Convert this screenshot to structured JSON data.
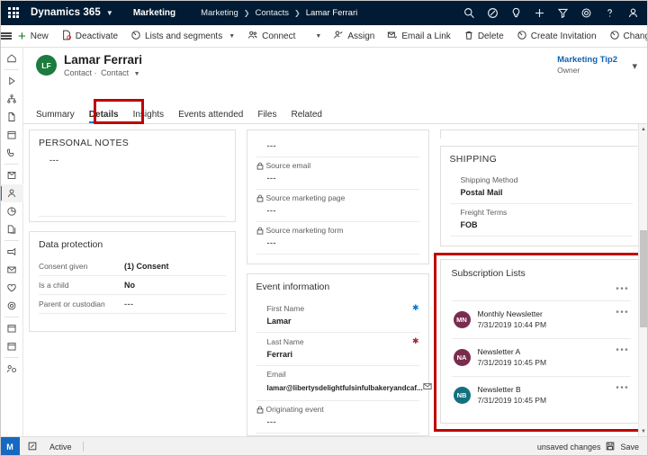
{
  "topnav": {
    "waffle_icon": "waffle-grid-icon",
    "brand": "Dynamics 365",
    "brand_chevron": "chevron-down-icon",
    "app_name": "Marketing",
    "breadcrumb": [
      "Marketing",
      "Contacts",
      "Lamar Ferrari"
    ],
    "icons": [
      "search-icon",
      "assistant-icon",
      "lightbulb-icon",
      "plus-icon",
      "filter-icon",
      "gear-icon",
      "help-icon",
      "person-icon"
    ]
  },
  "commandbar": {
    "menu_icon": "hamburger-icon",
    "items": [
      {
        "label": "New",
        "icon": "plus-icon",
        "chevron": false
      },
      {
        "label": "Deactivate",
        "icon": "deactivate-icon",
        "chevron": false
      },
      {
        "label": "Lists and segments",
        "icon": "circle-slash-icon",
        "chevron": true
      },
      {
        "label": "Connect",
        "icon": "connect-people-icon",
        "chevron": true
      },
      {
        "label": "Assign",
        "icon": "assign-person-icon",
        "chevron": false
      },
      {
        "label": "Email a Link",
        "icon": "email-link-icon",
        "chevron": false
      },
      {
        "label": "Delete",
        "icon": "trash-icon",
        "chevron": false
      },
      {
        "label": "Create Invitation",
        "icon": "circle-slash-icon",
        "chevron": false
      },
      {
        "label": "Change Password",
        "icon": "circle-slash-icon",
        "chevron": false
      }
    ],
    "overflow": "•••"
  },
  "rail": {
    "items": [
      {
        "name": "home-icon",
        "selected": false
      },
      {
        "name": "play-icon",
        "selected": false
      },
      {
        "name": "sitemap-icon",
        "selected": false
      },
      {
        "name": "file-icon",
        "selected": false
      },
      {
        "name": "calendar-icon",
        "selected": false
      },
      {
        "name": "phone-icon",
        "selected": false
      },
      {
        "name": "email-template-icon",
        "selected": false
      },
      {
        "name": "contact-person-icon",
        "selected": true
      },
      {
        "name": "pie-chart-icon",
        "selected": false
      },
      {
        "name": "segments-icon",
        "selected": false
      },
      {
        "name": "campaign-icon",
        "selected": false
      },
      {
        "name": "mail-icon",
        "selected": false
      },
      {
        "name": "heart-icon",
        "selected": false
      },
      {
        "name": "settings-gear-icon",
        "selected": false
      },
      {
        "name": "calendar-event-icon",
        "selected": false
      },
      {
        "name": "calendar-event2-icon",
        "selected": false
      },
      {
        "name": "social-icon",
        "selected": false
      }
    ]
  },
  "record": {
    "initials": "LF",
    "title": "Lamar Ferrari",
    "subtitle_entity": "Contact",
    "subtitle_sep": "·",
    "subtitle_form": "Contact",
    "subtitle_chevron": "chevron-down-icon",
    "owner_name": "Marketing Tip2",
    "owner_label": "Owner",
    "owner_chevron": "chevron-down-icon"
  },
  "tabs": [
    {
      "label": "Summary",
      "active": false
    },
    {
      "label": "Details",
      "active": true,
      "highlighted": true
    },
    {
      "label": "Insights",
      "active": false
    },
    {
      "label": "Events attended",
      "active": false
    },
    {
      "label": "Files",
      "active": false
    },
    {
      "label": "Related",
      "active": false
    }
  ],
  "column1": {
    "personal_notes": {
      "title": "PERSONAL NOTES",
      "value": "---"
    },
    "data_protection": {
      "title": "Data protection",
      "rows": [
        {
          "label": "Consent given",
          "value": "(1) Consent"
        },
        {
          "label": "Is a child",
          "value": "No"
        },
        {
          "label": "Parent or custodian",
          "value": "---"
        }
      ]
    }
  },
  "column2": {
    "top_partial_value": "---",
    "source_fields": [
      {
        "label": "Source email",
        "value": "---",
        "locked": true
      },
      {
        "label": "Source marketing page",
        "value": "---",
        "locked": true
      },
      {
        "label": "Source marketing form",
        "value": "---",
        "locked": true
      }
    ],
    "event_information": {
      "title": "Event information",
      "fields": [
        {
          "label": "First Name",
          "value": "Lamar",
          "required": "blue",
          "locked": false
        },
        {
          "label": "Last Name",
          "value": "Ferrari",
          "required": "red",
          "locked": false
        },
        {
          "label": "Email",
          "value": "lamar@libertysdelightfulsinfulbakeryandcaf...",
          "locked": false,
          "trailing_icon": "email-icon"
        },
        {
          "label": "Originating event",
          "value": "---",
          "locked": true
        }
      ]
    }
  },
  "column3": {
    "shipping": {
      "title": "SHIPPING",
      "rows": [
        {
          "label": "Shipping Method",
          "value": "Postal Mail"
        },
        {
          "label": "Freight Terms",
          "value": "FOB"
        }
      ]
    },
    "subscription_lists": {
      "title": "Subscription Lists",
      "overflow": "•••",
      "highlighted": true,
      "items": [
        {
          "initials": "MN",
          "name": "Monthly Newsletter",
          "date": "7/31/2019 10:44 PM",
          "color": "#7a2c4f",
          "overflow": "•••"
        },
        {
          "initials": "NA",
          "name": "Newsletter A",
          "date": "7/31/2019 10:45 PM",
          "color": "#7a2c4f",
          "overflow": "•••"
        },
        {
          "initials": "NB",
          "name": "Newsletter B",
          "date": "7/31/2019 10:45 PM",
          "color": "#14707e",
          "overflow": "•••"
        }
      ]
    }
  },
  "statusbar": {
    "badge": "M",
    "pin_icon": "pin-icon",
    "status": "Active",
    "unsaved": "unsaved changes",
    "save_icon": "save-disk-icon",
    "save_label": "Save"
  },
  "colors": {
    "navy": "#001b33",
    "accent_blue": "#0078d4",
    "highlight_red": "#c00000",
    "green_avatar": "#1b7c3d"
  }
}
